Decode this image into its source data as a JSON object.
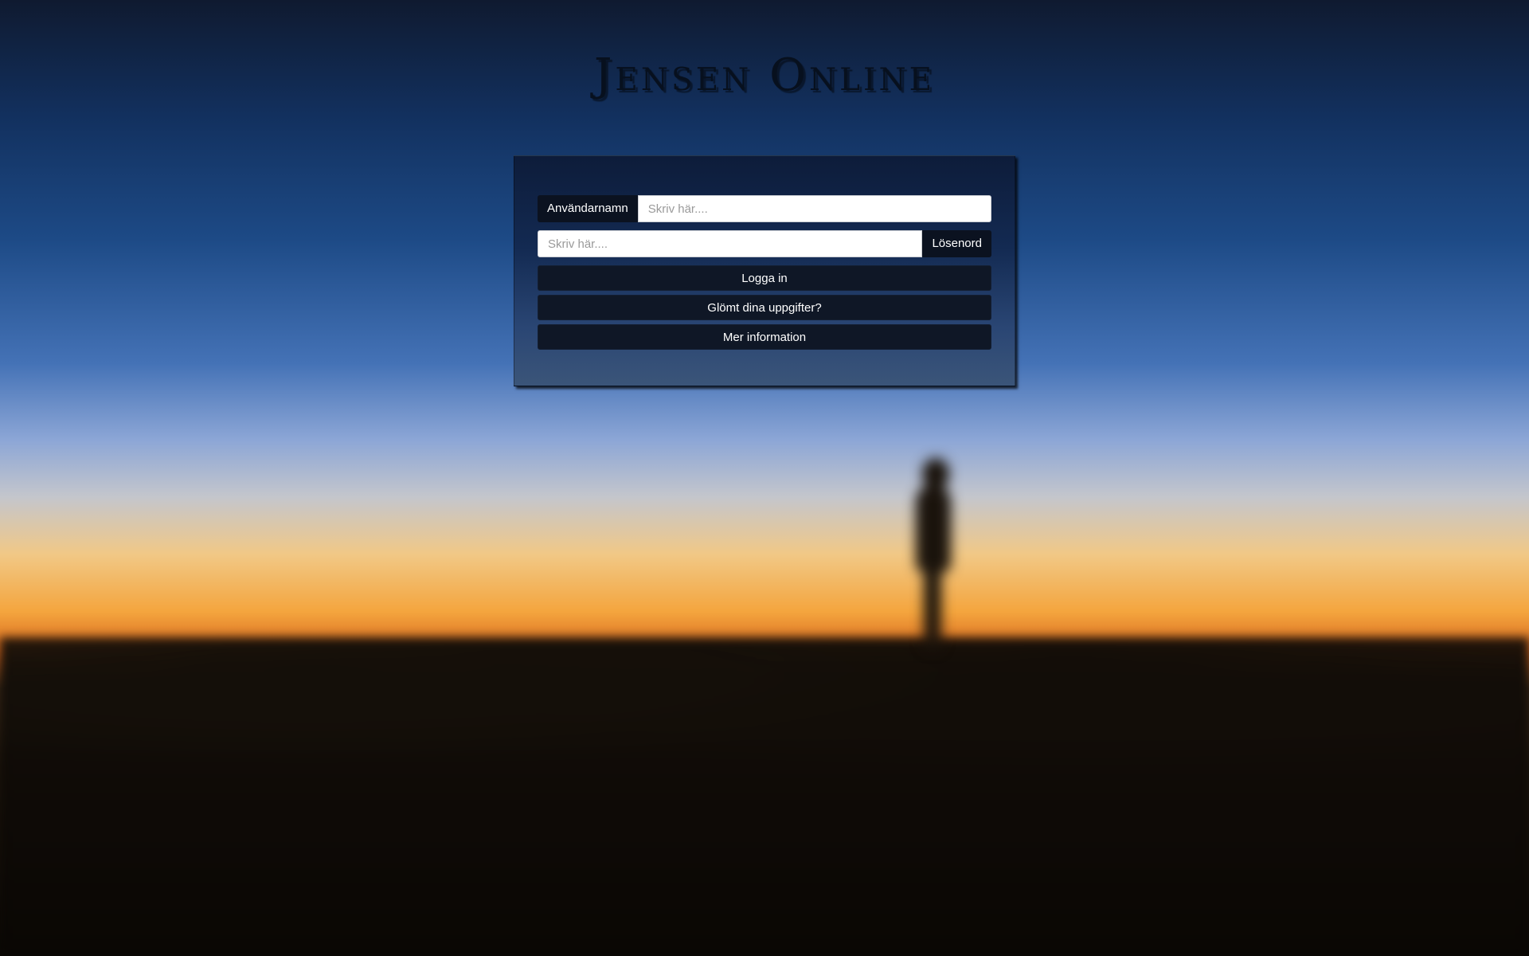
{
  "brand": {
    "title": "Jensen Online"
  },
  "login_form": {
    "username": {
      "label": "Användarnamn",
      "placeholder": "Skriv här....",
      "value": ""
    },
    "password": {
      "label": "Lösenord",
      "placeholder": "Skriv här....",
      "value": ""
    },
    "buttons": {
      "login": "Logga in",
      "forgot": "Glömt dina uppgifter?",
      "info": "Mer information"
    }
  },
  "colors": {
    "panel": "#132a52",
    "button": "#0f1726",
    "addon": "#0b1220",
    "brand_text": "#07101e"
  }
}
